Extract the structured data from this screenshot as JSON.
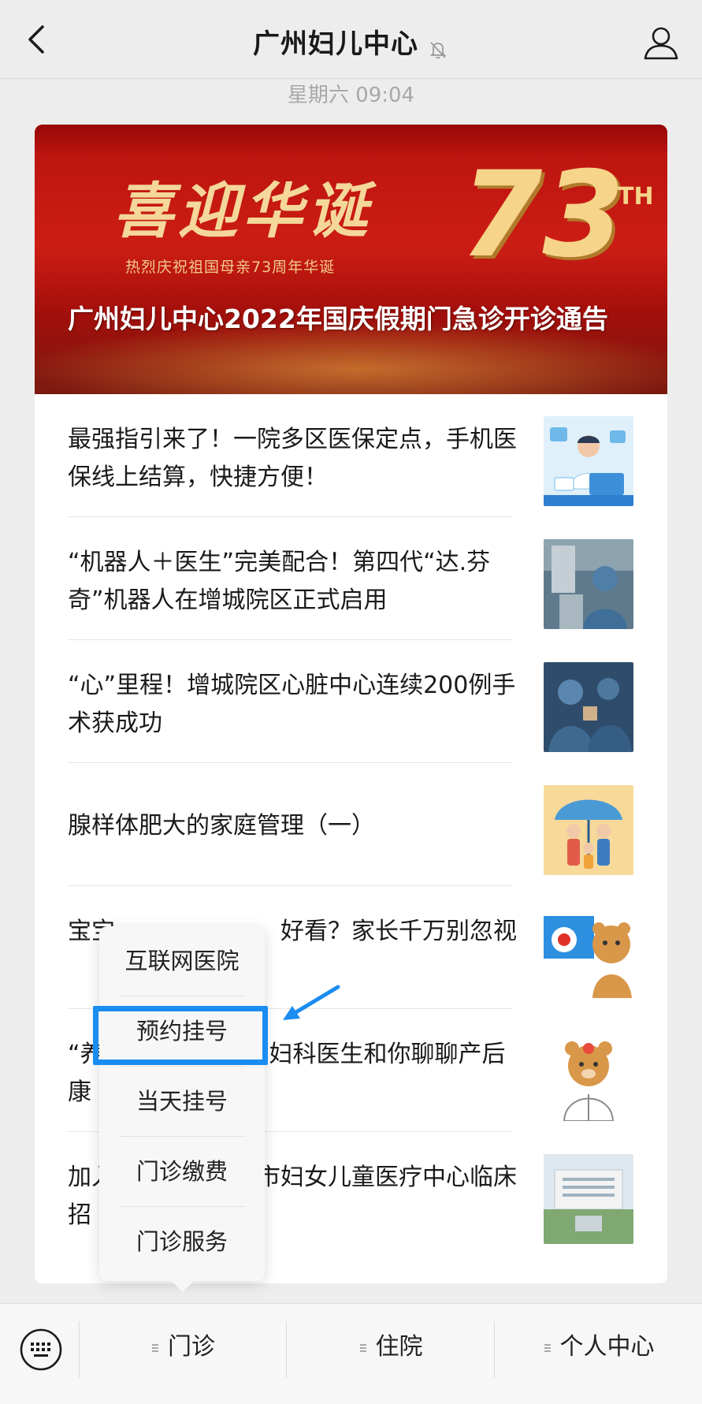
{
  "header": {
    "title": "广州妇儿中心"
  },
  "timestamp": "星期六 09:04",
  "banner": {
    "slogan": "喜迎华诞",
    "subtitle": "热烈庆祝祖国母亲73周年华诞",
    "number": "73",
    "superscript": "TH",
    "title": "广州妇儿中心2022年国庆假期门急诊开诊通告"
  },
  "articles": [
    {
      "title": "最强指引来了！一院多区医保定点，手机医保线上结算，快捷方便！"
    },
    {
      "title": "“机器人＋医生”完美配合！第四代“达.芬奇”机器人在增城院区正式启用"
    },
    {
      "title": "“心”里程！增城院区心脏中心连续200例手术获成功"
    },
    {
      "title": "腺样体肥大的家庭管理（一）"
    },
    {
      "title": "宝宝　　　　　　　好看？家长千万别忽视"
    },
    {
      "title": "“养　　　　　　　妇科医生和你聊聊产后康"
    },
    {
      "title": "加入　　　　　　市妇女儿童医疗中心临床招"
    }
  ],
  "popup_menu": {
    "items": [
      "互联网医院",
      "预约挂号",
      "当天挂号",
      "门诊缴费",
      "门诊服务"
    ],
    "highlighted": "预约挂号"
  },
  "bottom_tabs": {
    "items": [
      "门诊",
      "住院",
      "个人中心"
    ]
  },
  "colors": {
    "highlight": "#1b8cf0",
    "banner_red": "#c41a12",
    "gold": "#f6d48a"
  }
}
